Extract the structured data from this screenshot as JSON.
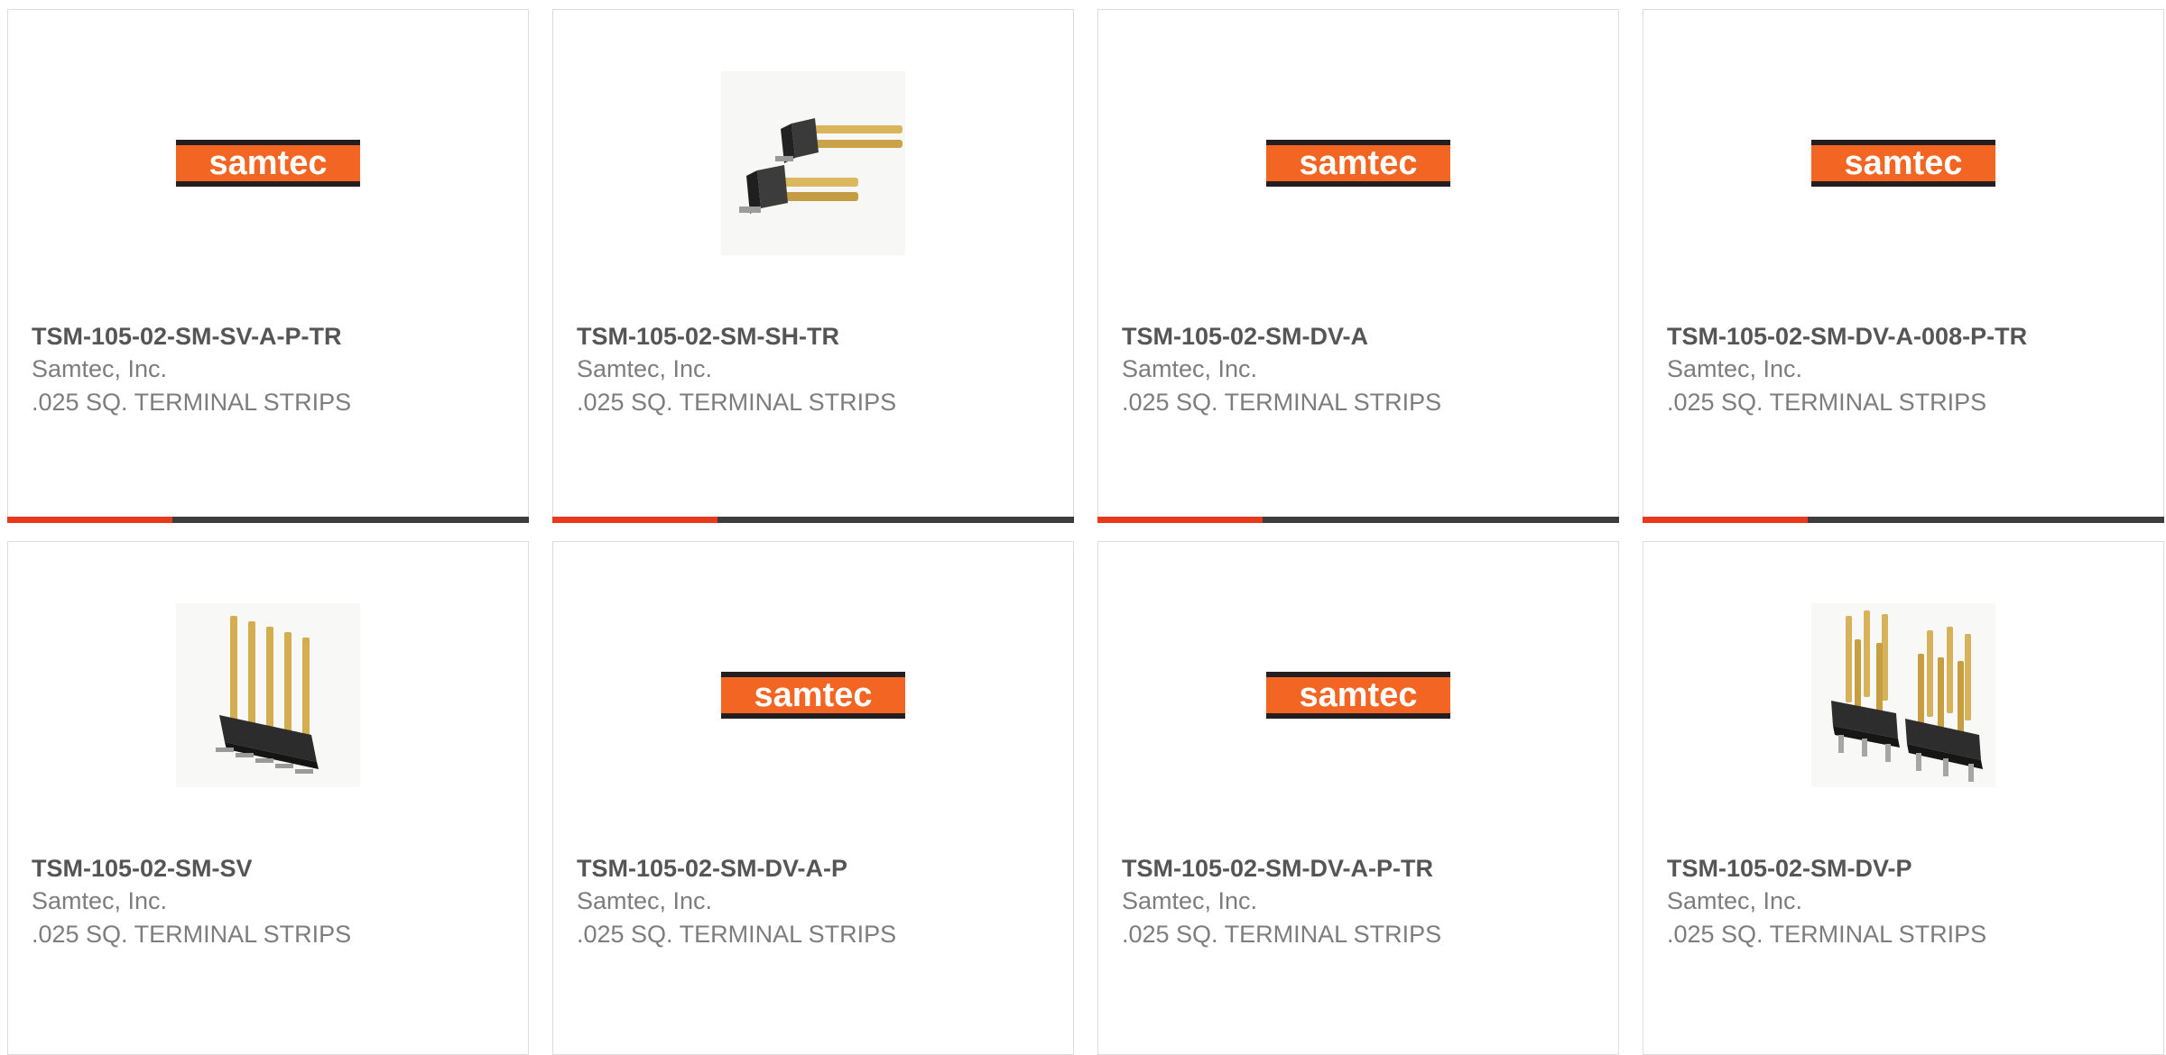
{
  "colors": {
    "accent": "#e8391d",
    "bar": "#3d3d3d",
    "border": "#dcdcdc",
    "title_text": "#555555",
    "body_text": "#7d7d7d",
    "logo_orange": "#f26522"
  },
  "products": [
    {
      "part_number": "TSM-105-02-SM-SV-A-P-TR",
      "manufacturer": "Samtec, Inc.",
      "description": ".025 SQ. TERMINAL STRIPS",
      "image": "samtec-logo",
      "logo_text": "samtec"
    },
    {
      "part_number": "TSM-105-02-SM-SH-TR",
      "manufacturer": "Samtec, Inc.",
      "description": ".025 SQ. TERMINAL STRIPS",
      "image": "horizontal-header-photo"
    },
    {
      "part_number": "TSM-105-02-SM-DV-A",
      "manufacturer": "Samtec, Inc.",
      "description": ".025 SQ. TERMINAL STRIPS",
      "image": "samtec-logo",
      "logo_text": "samtec"
    },
    {
      "part_number": "TSM-105-02-SM-DV-A-008-P-TR",
      "manufacturer": "Samtec, Inc.",
      "description": ".025 SQ. TERMINAL STRIPS",
      "image": "samtec-logo",
      "logo_text": "samtec"
    },
    {
      "part_number": "TSM-105-02-SM-SV",
      "manufacturer": "Samtec, Inc.",
      "description": ".025 SQ. TERMINAL STRIPS",
      "image": "single-row-header-photo"
    },
    {
      "part_number": "TSM-105-02-SM-DV-A-P",
      "manufacturer": "Samtec, Inc.",
      "description": ".025 SQ. TERMINAL STRIPS",
      "image": "samtec-logo",
      "logo_text": "samtec"
    },
    {
      "part_number": "TSM-105-02-SM-DV-A-P-TR",
      "manufacturer": "Samtec, Inc.",
      "description": ".025 SQ. TERMINAL STRIPS",
      "image": "samtec-logo",
      "logo_text": "samtec"
    },
    {
      "part_number": "TSM-105-02-SM-DV-P",
      "manufacturer": "Samtec, Inc.",
      "description": ".025 SQ. TERMINAL STRIPS",
      "image": "double-row-header-photo"
    }
  ]
}
